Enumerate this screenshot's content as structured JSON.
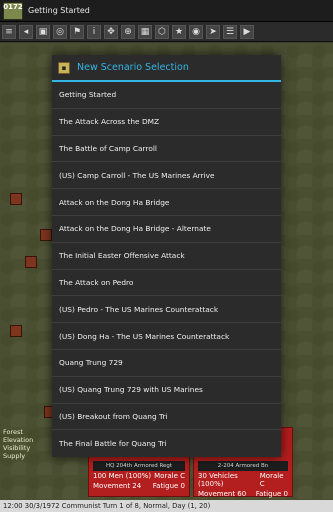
{
  "app": {
    "icon_text": "0172",
    "title": "Getting Started"
  },
  "toolbar": {
    "icons": [
      "menu-icon",
      "back-icon",
      "unit-icon",
      "target-icon",
      "flag-icon",
      "info-icon",
      "move-icon",
      "zoom-icon",
      "grid-icon",
      "hex-icon",
      "star-icon",
      "eye-icon",
      "cursor-icon",
      "list-icon",
      "end-turn-icon"
    ]
  },
  "dialog": {
    "title": "New Scenario Selection",
    "items": [
      "Getting Started",
      "The Attack Across the DMZ",
      "The Battle of Camp Carroll",
      "(US) Camp Carroll - The US Marines Arrive",
      "Attack on the Dong Ha Bridge",
      "Attack on the Dong Ha Bridge - Alternate",
      "The Initial Easter Offensive Attack",
      "The Attack on Pedro",
      "(US) Pedro - The US Marines Counterattack",
      "(US) Dong Ha - The US Marines Counterattack",
      "Quang Trung 729",
      "(US) Quang Trung 729 with US Marines",
      "(US) Breakout from Quang Tri",
      "The Final Battle for Quang Tri"
    ]
  },
  "terrain_info": [
    "Forest",
    "Elevation",
    "Visibility",
    "Supply"
  ],
  "unit_panels": [
    {
      "name": "HQ 204th Armored Regt",
      "strength": "100 Men (100%)",
      "morale": "Morale C",
      "movement": "Movement 24",
      "fatigue": "Fatigue 0"
    },
    {
      "name": "2-204 Armored Bn",
      "strength": "30 Vehicles (100%)",
      "morale": "Morale C",
      "movement": "Movement 60",
      "fatigue": "Fatigue 0"
    }
  ],
  "status": {
    "text": "12:00 30/3/1972 Communist Turn 1 of 8, Normal, Day (1, 20)"
  },
  "colors": {
    "accent": "#33b5e5",
    "dialog_bg": "#2b2b2b",
    "unit_panel_red": "#b31e1e"
  }
}
